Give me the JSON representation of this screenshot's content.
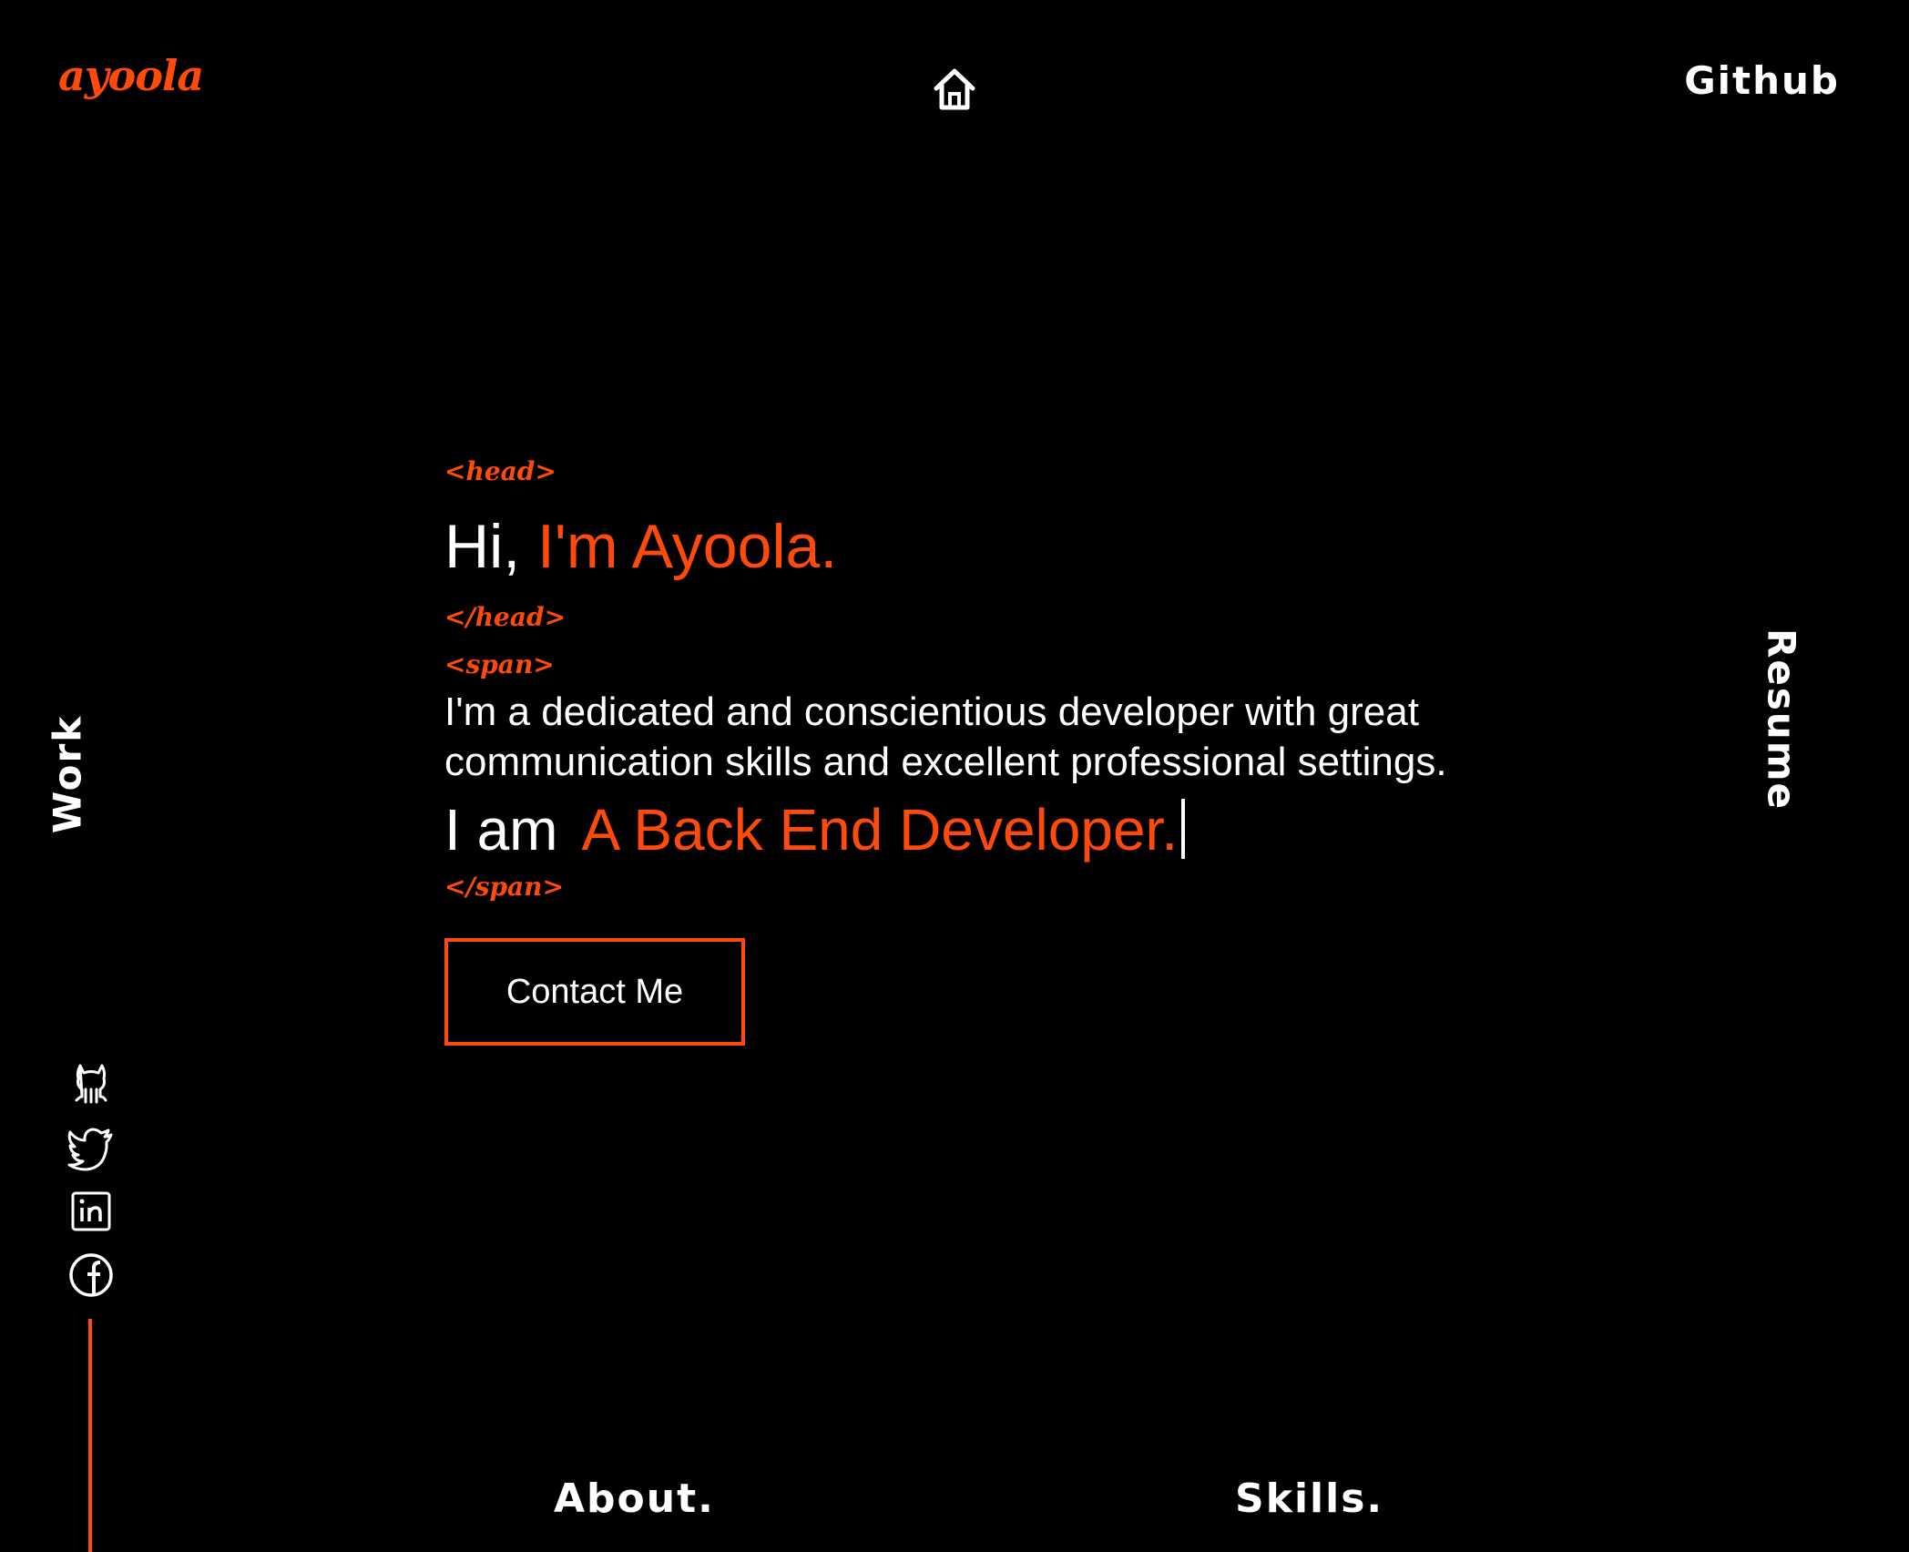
{
  "brand": {
    "logo_text": "ayoola"
  },
  "nav": {
    "home_icon": "home-icon",
    "github_label": "Github",
    "work_label": "Work",
    "resume_label": "Resume",
    "about_label": "About.",
    "skills_label": "Skills."
  },
  "hero": {
    "open_head_tag": "<head>",
    "greeting_prefix": "Hi,",
    "greeting_name": "I'm Ayoola.",
    "close_head_tag": "</head>",
    "open_span_tag": "<span>",
    "bio": "I'm a dedicated and conscientious developer with great communication skills and excellent professional settings.",
    "role_prefix": "I am",
    "role_typed": "A Back End Developer.",
    "close_span_tag": "</span>",
    "contact_label": "Contact Me"
  },
  "socials": [
    {
      "icon": "github-icon"
    },
    {
      "icon": "twitter-icon"
    },
    {
      "icon": "linkedin-icon"
    },
    {
      "icon": "facebook-icon"
    }
  ],
  "colors": {
    "background": "#000000",
    "accent": "#ff4a0a",
    "text": "#ffffff"
  }
}
